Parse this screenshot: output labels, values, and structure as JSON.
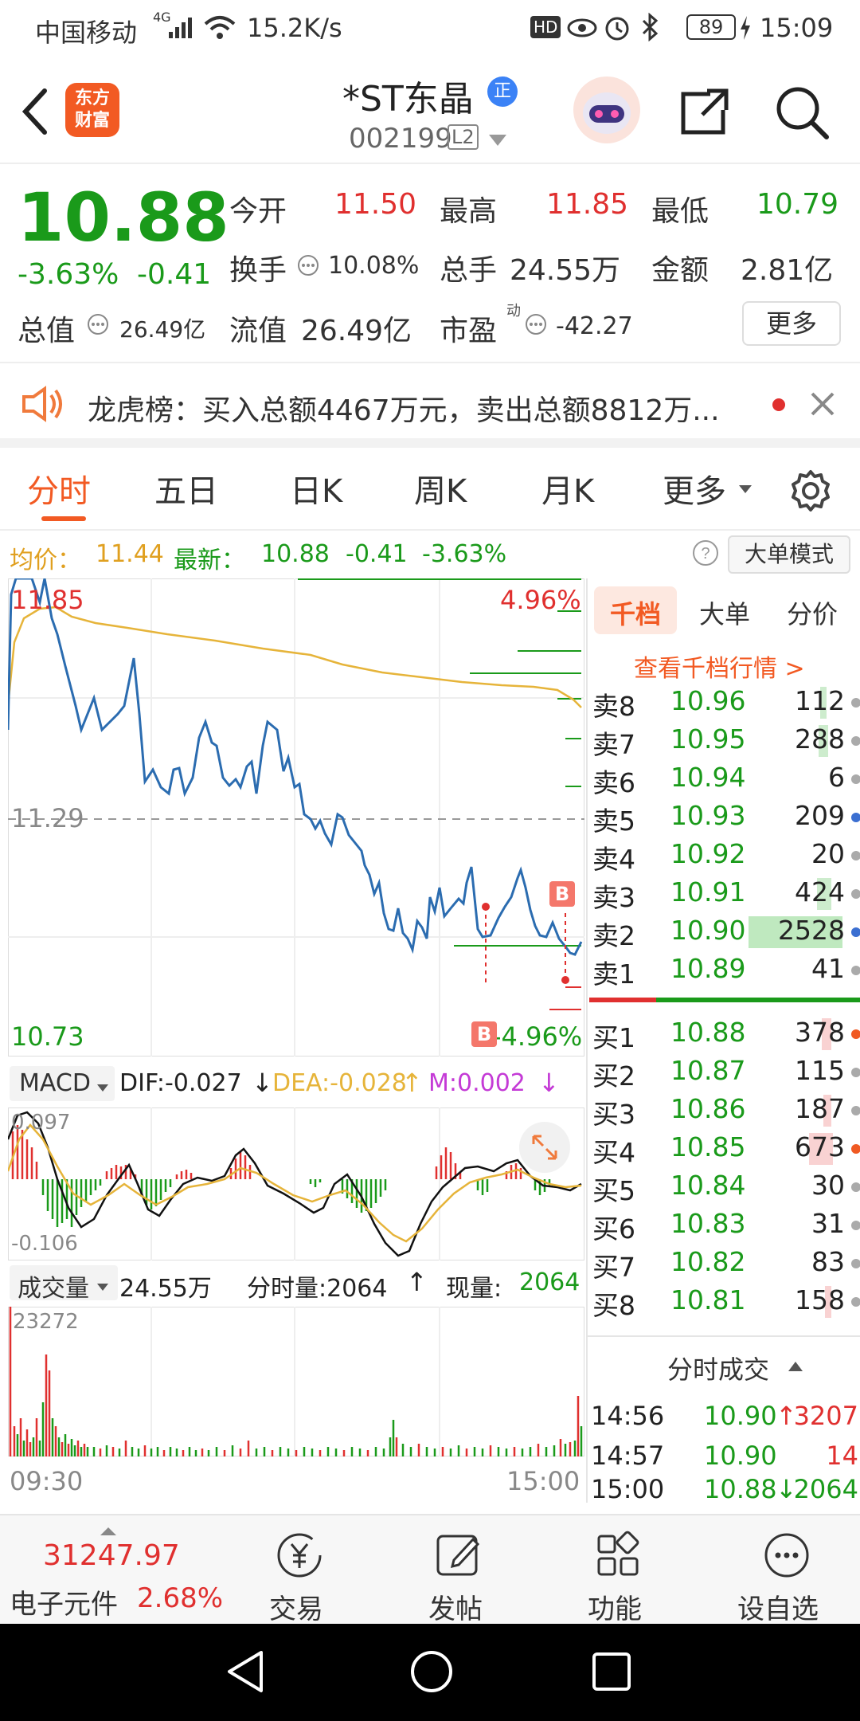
{
  "status_bar": {
    "carrier": "中国移动",
    "signal": "4G",
    "speed": "15.2K/s",
    "hd": "HD",
    "battery": "89",
    "time": "15:09"
  },
  "header": {
    "app_logo_line1": "东方",
    "app_logo_line2": "财富",
    "title": "*ST东晶",
    "title_badge": "正",
    "code": "002199",
    "level": "L2"
  },
  "quote": {
    "price": "10.88",
    "change_pct": "-3.63%",
    "change": "-0.41",
    "open_label": "今开",
    "open": "11.50",
    "high_label": "最高",
    "high": "11.85",
    "low_label": "最低",
    "low": "10.79",
    "turnover_label": "换手",
    "turnover": "10.08%",
    "volume_label": "总手",
    "volume": "24.55万",
    "amount_label": "金额",
    "amount": "2.81亿",
    "mktcap_label": "总值",
    "mktcap": "26.49亿",
    "float_label": "流值",
    "float_cap": "26.49亿",
    "pe_label": "市盈",
    "pe_sup": "动",
    "pe": "-42.27",
    "more_label": "更多"
  },
  "notice": {
    "text": "龙虎榜：买入总额4467万元，卖出总额8812万..."
  },
  "tabs": [
    "分时",
    "五日",
    "日K",
    "周K",
    "月K",
    "更多"
  ],
  "info_bar": {
    "avg_label": "均价：",
    "avg": "11.44",
    "latest_label": "最新：",
    "latest": "10.88",
    "latest_change": "-0.41",
    "latest_pct": "-3.63%",
    "mode_btn": "大单模式"
  },
  "chart": {
    "y_high": "11.85",
    "y_mid": "11.29",
    "y_low": "10.73",
    "pct_high": "4.96%",
    "pct_low": "-4.96%",
    "b_marker": "B",
    "time_start": "09:30",
    "time_end": "15:00",
    "colors": {
      "price": "#2b6cb0",
      "avg": "#e6b43a",
      "up": "#e0302f",
      "down": "#1a9a1a"
    }
  },
  "macd": {
    "name": "MACD",
    "dif": "DIF:-0.027",
    "dif_arrow": "↓",
    "dea": "DEA:-0.028",
    "dea_arrow": "↑",
    "m": "M:0.002",
    "m_arrow": "↓",
    "top_val": "0.097",
    "bottom_val": "-0.106"
  },
  "volume_ind": {
    "name": "成交量",
    "total": "24.55万",
    "tick_label": "分时量:2064",
    "tick_arrow": "↑",
    "now_label": "现量:",
    "now": "2064",
    "max_val": "23272"
  },
  "side_tabs": [
    "千档",
    "大单",
    "分价"
  ],
  "side_link": "查看千档行情 >",
  "asks": [
    {
      "label": "卖8",
      "price": "10.96",
      "vol": "112"
    },
    {
      "label": "卖7",
      "price": "10.95",
      "vol": "288"
    },
    {
      "label": "卖6",
      "price": "10.94",
      "vol": "6"
    },
    {
      "label": "卖5",
      "price": "10.93",
      "vol": "209"
    },
    {
      "label": "卖4",
      "price": "10.92",
      "vol": "20"
    },
    {
      "label": "卖3",
      "price": "10.91",
      "vol": "424"
    },
    {
      "label": "卖2",
      "price": "10.90",
      "vol": "2528"
    },
    {
      "label": "卖1",
      "price": "10.89",
      "vol": "41"
    }
  ],
  "bids": [
    {
      "label": "买1",
      "price": "10.88",
      "vol": "378"
    },
    {
      "label": "买2",
      "price": "10.87",
      "vol": "115"
    },
    {
      "label": "买3",
      "price": "10.86",
      "vol": "187"
    },
    {
      "label": "买4",
      "price": "10.85",
      "vol": "673"
    },
    {
      "label": "买5",
      "price": "10.84",
      "vol": "30"
    },
    {
      "label": "买6",
      "price": "10.83",
      "vol": "31"
    },
    {
      "label": "买7",
      "price": "10.82",
      "vol": "83"
    },
    {
      "label": "买8",
      "price": "10.81",
      "vol": "158"
    }
  ],
  "trades_title": "分时成交",
  "trades": [
    {
      "time": "14:56",
      "price": "10.90",
      "dir": "↑",
      "vol": "3207"
    },
    {
      "time": "14:57",
      "price": "10.90",
      "dir": "",
      "vol": "14"
    },
    {
      "time": "15:00",
      "price": "10.88",
      "dir": "↓",
      "vol": "2064"
    }
  ],
  "bottom": {
    "index_val": "31247.97",
    "index_name": "电子元件",
    "index_pct": "2.68%",
    "items": [
      {
        "label": "交易",
        "icon": "yen-circle-icon"
      },
      {
        "label": "发帖",
        "icon": "edit-icon"
      },
      {
        "label": "功能",
        "icon": "grid-icon"
      },
      {
        "label": "设自选",
        "icon": "more-circle-icon"
      }
    ]
  }
}
